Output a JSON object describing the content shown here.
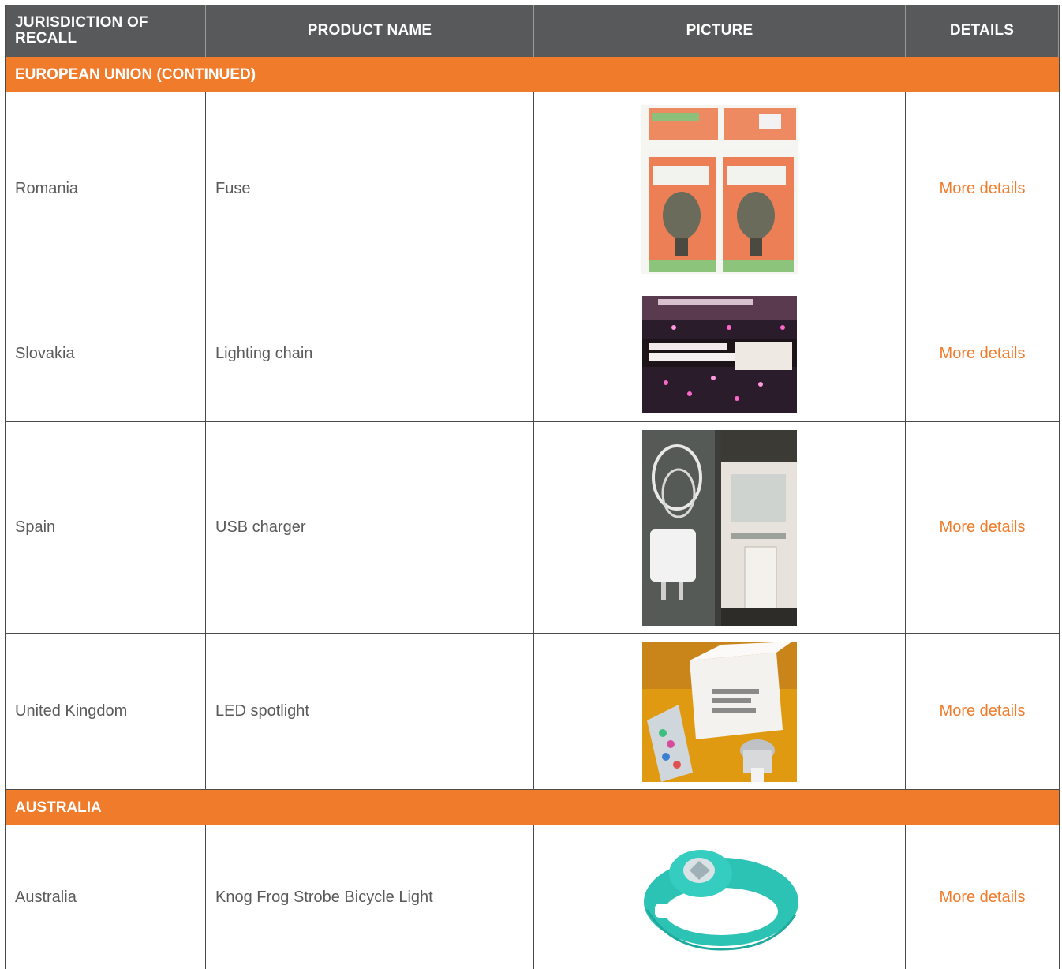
{
  "header": {
    "col_jurisdiction": "JURISDICTION OF RECALL",
    "col_product": "PRODUCT NAME",
    "col_picture": "PICTURE",
    "col_details": "DETAILS"
  },
  "sections": [
    {
      "title": "EUROPEAN UNION (CONTINUED)",
      "rows": [
        {
          "jurisdiction": "Romania",
          "product": "Fuse",
          "details": "More details",
          "picture": "boxed-fuse-photo"
        },
        {
          "jurisdiction": "Slovakia",
          "product": "Lighting chain",
          "details": "More details",
          "picture": "lighting-chain-box-photo"
        },
        {
          "jurisdiction": "Spain",
          "product": "USB charger",
          "details": "More details",
          "picture": "usb-charger-photo"
        },
        {
          "jurisdiction": "United Kingdom",
          "product": "LED spotlight",
          "details": "More details",
          "picture": "led-spotlight-photo"
        }
      ]
    },
    {
      "title": "AUSTRALIA",
      "rows": [
        {
          "jurisdiction": "Australia",
          "product": "Knog Frog Strobe Bicycle Light",
          "details": "More details",
          "picture": "bicycle-light-photo"
        }
      ]
    }
  ],
  "colors": {
    "header_bg": "#58595b",
    "section_bg": "#f07b2b",
    "link": "#f07b2b",
    "body_text": "#5a5a5a"
  }
}
